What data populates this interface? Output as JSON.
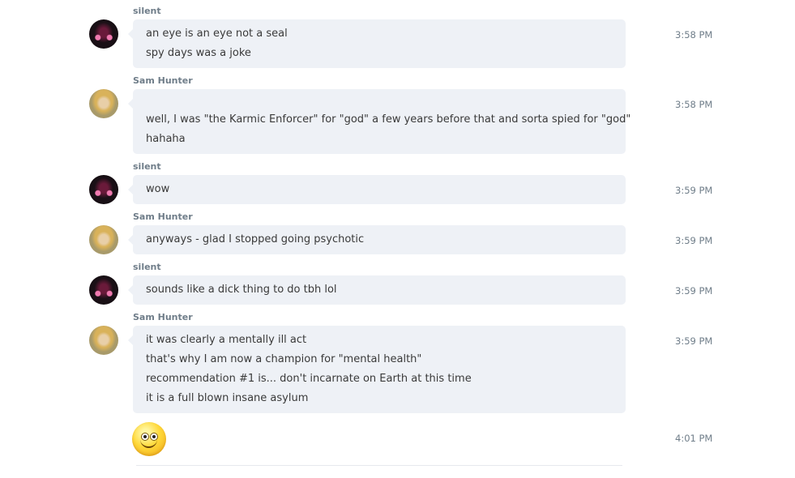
{
  "messages": [
    {
      "sender": "silent",
      "time": "3:58 PM",
      "lines": [
        "an eye is an eye not a seal",
        "spy days was a joke"
      ]
    },
    {
      "sender": "Sam Hunter",
      "time": "3:58 PM",
      "lines": [
        "well, I was \"the Karmic Enforcer\" for \"god\" a few years before that and sorta spied for \"god\"",
        "hahaha"
      ]
    },
    {
      "sender": "silent",
      "time": "3:59 PM",
      "lines": [
        "wow"
      ]
    },
    {
      "sender": "Sam Hunter",
      "time": "3:59 PM",
      "lines": [
        "anyways - glad I stopped going psychotic"
      ]
    },
    {
      "sender": "silent",
      "time": "3:59 PM",
      "lines": [
        "sounds like a dick thing to do tbh lol"
      ]
    },
    {
      "sender": "Sam Hunter",
      "time": "3:59 PM",
      "lines": [
        "it was clearly a mentally ill act",
        "that's why I am now a champion for \"mental health\"",
        "recommendation #1 is... don't incarnate on Earth at this time",
        "it is a full blown insane asylum"
      ]
    }
  ],
  "emoji_message": {
    "icon": "smiley-emoji-icon",
    "time": "4:01 PM"
  }
}
